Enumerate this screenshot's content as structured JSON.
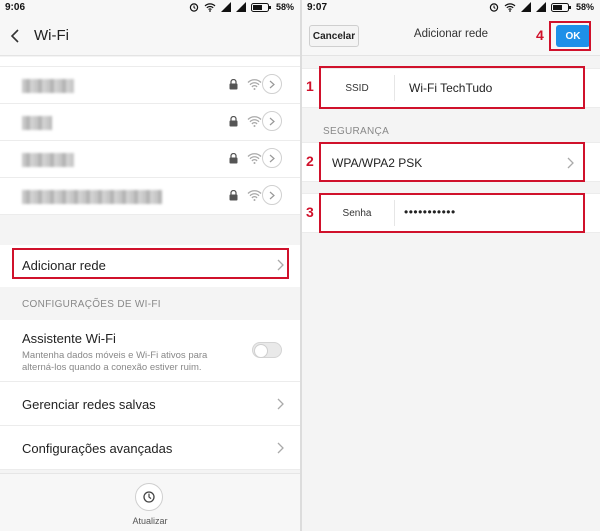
{
  "left": {
    "status_time": "9:06",
    "battery": "58%",
    "title": "Wi-Fi",
    "networks": [
      {
        "blur_width": 52
      },
      {
        "blur_width": 30
      },
      {
        "blur_width": 52
      },
      {
        "blur_width": 140
      }
    ],
    "add_network_label": "Adicionar rede",
    "section_label": "CONFIGURAÇÕES DE WI-FI",
    "assistant_title": "Assistente Wi-Fi",
    "assistant_subtitle": "Mantenha dados móveis e Wi-Fi ativos para alterná-los quando a conexão estiver ruim.",
    "manage_saved": "Gerenciar redes salvas",
    "advanced": "Configurações avançadas",
    "refresh_label": "Atualizar"
  },
  "right": {
    "status_time": "9:07",
    "battery": "58%",
    "cancel_label": "Cancelar",
    "title": "Adicionar rede",
    "ok_label": "OK",
    "ssid_label": "SSID",
    "ssid_value": "Wi-Fi TechTudo",
    "security_section": "SEGURANÇA",
    "security_value": "WPA/WPA2 PSK",
    "password_label": "Senha",
    "password_value": "•••••••••••"
  },
  "markers": [
    "1",
    "2",
    "3",
    "4"
  ],
  "colors": {
    "highlight": "#d0112b",
    "ok_button": "#1e90e8"
  }
}
